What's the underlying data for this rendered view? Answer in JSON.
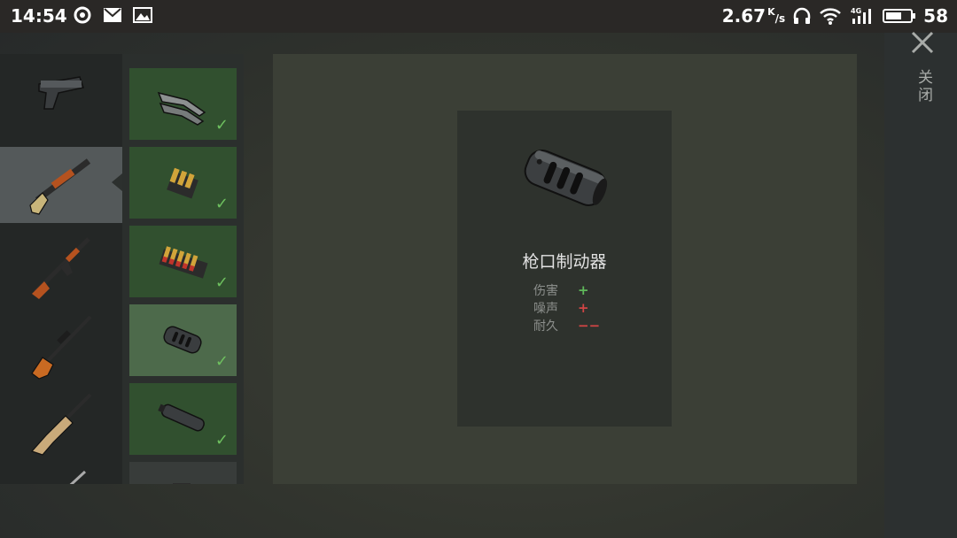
{
  "status_bar": {
    "time": "14:54",
    "net_speed": "2.67",
    "net_speed_unit_top": "K",
    "net_speed_unit_bottom": "/s",
    "network_type": "4G",
    "battery": "58",
    "icons": [
      "nav-icon",
      "mail-icon",
      "gallery-icon",
      "headphones-icon",
      "wifi-icon",
      "signal-icon",
      "battery-icon"
    ]
  },
  "weapons": [
    {
      "name": "pistol-icon",
      "selected": false
    },
    {
      "name": "shotgun-icon",
      "selected": true
    },
    {
      "name": "assault-rifle-icon",
      "selected": false
    },
    {
      "name": "sniper-rifle-icon",
      "selected": false
    },
    {
      "name": "scar-rifle-icon",
      "selected": false
    },
    {
      "name": "rifle-partial-icon",
      "selected": false
    }
  ],
  "attachments": [
    {
      "name": "stock-attachment-icon",
      "unlocked": true,
      "selected": false
    },
    {
      "name": "shell-holder-small-icon",
      "unlocked": true,
      "selected": false
    },
    {
      "name": "shell-holder-large-icon",
      "unlocked": true,
      "selected": false
    },
    {
      "name": "muzzle-brake-icon",
      "unlocked": true,
      "selected": true
    },
    {
      "name": "suppressor-icon",
      "unlocked": true,
      "selected": false
    },
    {
      "name": "locked-attachment-icon",
      "unlocked": false,
      "selected": false
    }
  ],
  "detail": {
    "title": "枪口制动器",
    "image": "muzzle-brake-icon",
    "stats": [
      {
        "label": "伤害",
        "value": "+",
        "color": "#5fb85a"
      },
      {
        "label": "噪声",
        "value": "+",
        "color": "#d24545"
      },
      {
        "label": "耐久",
        "value": "−−",
        "color": "#d24545"
      }
    ]
  },
  "close": {
    "icon": "close-icon",
    "label": "关闭"
  },
  "colors": {
    "attachment_bg": "#31502f",
    "attachment_selected_bg": "#4d6a4b",
    "check_green": "#6ec05f",
    "weapon_selected_bg": "#54595a"
  }
}
